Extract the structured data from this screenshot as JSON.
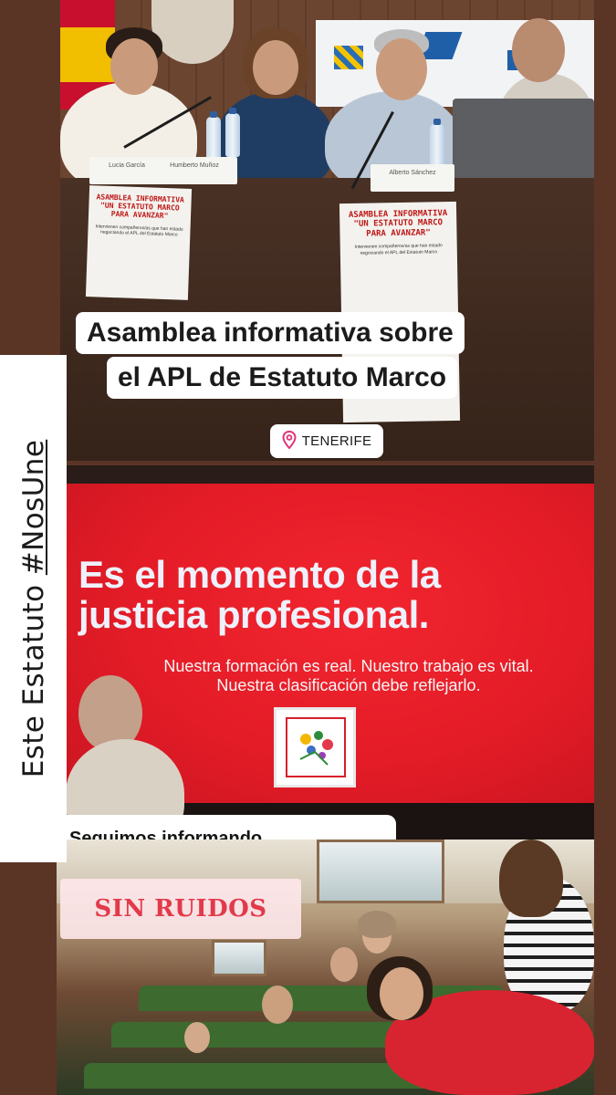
{
  "story": {
    "vertical_caption_prefix": "Este Estatuto",
    "vertical_caption_hashtag": "#NosUne",
    "headline_line1": "Asamblea informativa sobre",
    "headline_line2": "el APL de Estatuto Marco",
    "location_label": "TENERIFE",
    "seguimos_label": "Seguimos informando",
    "sin_ruidos_label": "SIN RUIDOS"
  },
  "photo1": {
    "poster_title": "ASAMBLEA INFORMATIVA",
    "poster_subtitle": "\"UN ESTATUTO MARCO PARA AVANZAR\"",
    "poster_small": "Intervienen compañeros/as que han estado negociando el APL del Estatuto Marco",
    "nameplates": [
      "Lucia García",
      "Humberto Muñoz",
      "Alberto Sánchez"
    ]
  },
  "slide": {
    "title_line1": "Es el momento de la",
    "title_line2": "justicia profesional.",
    "body_line1": "Nuestra formación es real. Nuestro trabajo es vital.",
    "body_line2": "Nuestra clasificación debe reflejarlo."
  },
  "colors": {
    "slide_red": "#e41c27",
    "sin_ruidos_text": "#e23a4c",
    "sin_ruidos_bg": "#fde6e9",
    "location_pin": "#e0337a",
    "background_brown": "#5a3526"
  },
  "icons": {
    "location": "location-pin-icon"
  }
}
